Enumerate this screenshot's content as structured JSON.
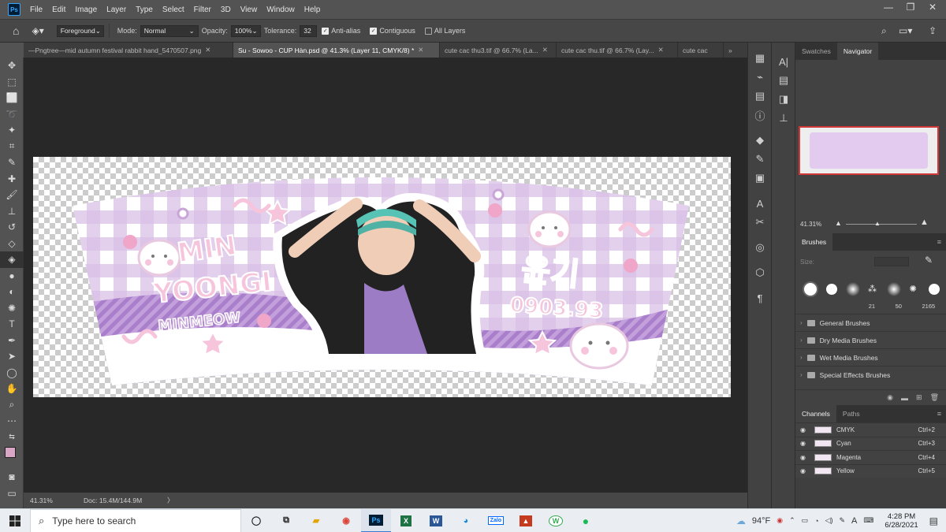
{
  "app": {
    "logo": "Ps"
  },
  "menu": [
    "File",
    "Edit",
    "Image",
    "Layer",
    "Type",
    "Select",
    "Filter",
    "3D",
    "View",
    "Window",
    "Help"
  ],
  "window_controls": {
    "minimize": "—",
    "restore": "❐",
    "close": "✕"
  },
  "options": {
    "fill_source": "Foreground",
    "mode_label": "Mode:",
    "mode_value": "Normal",
    "opacity_label": "Opacity:",
    "opacity_value": "100%",
    "tolerance_label": "Tolerance:",
    "tolerance_value": "32",
    "anti_alias": "Anti-alias",
    "contiguous": "Contiguous",
    "all_layers": "All Layers"
  },
  "tabs": [
    {
      "label": "—Pngtree—mid autumn festival rabbit hand_5470507.png",
      "close": "✕"
    },
    {
      "label": "Su - Sowoo - CUP Hàn.psd @ 41.3% (Layer 11, CMYK/8) *",
      "close": "✕"
    },
    {
      "label": "cute cac thu3.tif @ 66.7% (La...",
      "close": "✕"
    },
    {
      "label": "cute cac thu.tif @ 66.7% (Lay...",
      "close": "✕"
    },
    {
      "label": "cute cac",
      "close": ""
    }
  ],
  "tabs_overflow": "»",
  "artwork": {
    "line1": "MIN",
    "line2": "YOONGI",
    "line3": "MINMEOW",
    "korean": "윤기",
    "date": "0903.93",
    "colors": {
      "lilac": "#c8a6d8",
      "pink": "#f6c5dc",
      "deep": "#9d6fc0",
      "white": "#ffffff"
    }
  },
  "status": {
    "zoom": "41.31%",
    "doc": "Doc: 15.4M/144.9M",
    "arrow": "〉"
  },
  "panels": {
    "swatches_tab": "Swatches",
    "navigator_tab": "Navigator",
    "navigator_zoom": "41.31%",
    "brushes_tab": "Brushes",
    "size_label": "Size:",
    "brush_sizes": [
      "21",
      "50",
      "2165"
    ],
    "brush_folders": [
      "General Brushes",
      "Dry Media Brushes",
      "Wet Media Brushes",
      "Special Effects Brushes"
    ],
    "channels_tab": "Channels",
    "paths_tab": "Paths",
    "channels": [
      {
        "name": "CMYK",
        "shortcut": "Ctrl+2"
      },
      {
        "name": "Cyan",
        "shortcut": "Ctrl+3"
      },
      {
        "name": "Magenta",
        "shortcut": "Ctrl+4"
      },
      {
        "name": "Yellow",
        "shortcut": "Ctrl+5"
      }
    ]
  },
  "taskbar": {
    "search_placeholder": "Type here to search",
    "apps": [
      "Task view",
      "Widgets",
      "File Explorer",
      "Chrome",
      "Photoshop",
      "Excel",
      "Word",
      "Edge",
      "Zalo",
      "App",
      "W",
      "Spotify"
    ],
    "weather": "94°F",
    "ime": "A",
    "time": "4:28 PM",
    "date": "6/28/2021"
  }
}
